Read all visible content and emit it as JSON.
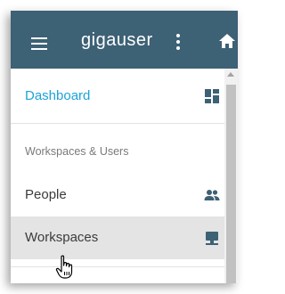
{
  "header": {
    "username": "gigauser",
    "menu_icon": "hamburger-menu-icon",
    "more_icon": "more-vert-icon",
    "home_icon": "home-icon",
    "background_color": "#3d6175"
  },
  "drawer": {
    "items": [
      {
        "label": "Dashboard",
        "icon": "dashboard-icon",
        "active": true,
        "color": "#1ba3d8"
      },
      {
        "label": "People",
        "icon": "people-icon"
      },
      {
        "label": "Workspaces",
        "icon": "workspaces-icon",
        "hovered": true
      }
    ],
    "section_header": "Workspaces & Users"
  }
}
